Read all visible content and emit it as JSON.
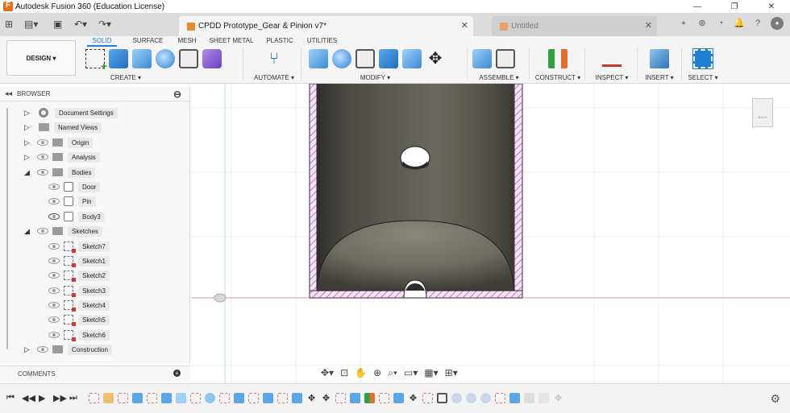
{
  "window": {
    "title": "Autodesk Fusion 360 (Education License)",
    "controls": [
      "—",
      "❐",
      "✕"
    ]
  },
  "tabs": {
    "active": "CPDD Prototype_Gear & Pinion v7*",
    "inactive": "Untitled",
    "close": "✕",
    "add": "+"
  },
  "ribbon": {
    "workspace": "DESIGN ▾",
    "tabs": [
      "SOLID",
      "SURFACE",
      "MESH",
      "SHEET METAL",
      "PLASTIC",
      "UTILITIES"
    ],
    "groups": [
      "CREATE ▾",
      "AUTOMATE ▾",
      "MODIFY ▾",
      "ASSEMBLE ▾",
      "CONSTRUCT ▾",
      "INSPECT ▾",
      "INSERT ▾",
      "SELECT ▾"
    ]
  },
  "browser": {
    "title": "BROWSER",
    "items": [
      {
        "label": "Document Settings"
      },
      {
        "label": "Named Views"
      },
      {
        "label": "Origin"
      },
      {
        "label": "Analysis"
      },
      {
        "label": "Bodies"
      },
      {
        "label": "Door"
      },
      {
        "label": "Pin"
      },
      {
        "label": "Body3"
      },
      {
        "label": "Sketches"
      },
      {
        "label": "Sketch7"
      },
      {
        "label": "Sketch1"
      },
      {
        "label": "Sketch2"
      },
      {
        "label": "Sketch3"
      },
      {
        "label": "Sketch4"
      },
      {
        "label": "Sketch5"
      },
      {
        "label": "Sketch6"
      },
      {
        "label": "Construction"
      }
    ]
  },
  "comments": {
    "title": "COMMENTS"
  },
  "viewcube": {
    "face": "BACK"
  },
  "colors": {
    "accent": "#1e7fd6",
    "hatch": "#c04cc0",
    "body_dark": "#3a3a36",
    "body_mid": "#7a776c"
  }
}
